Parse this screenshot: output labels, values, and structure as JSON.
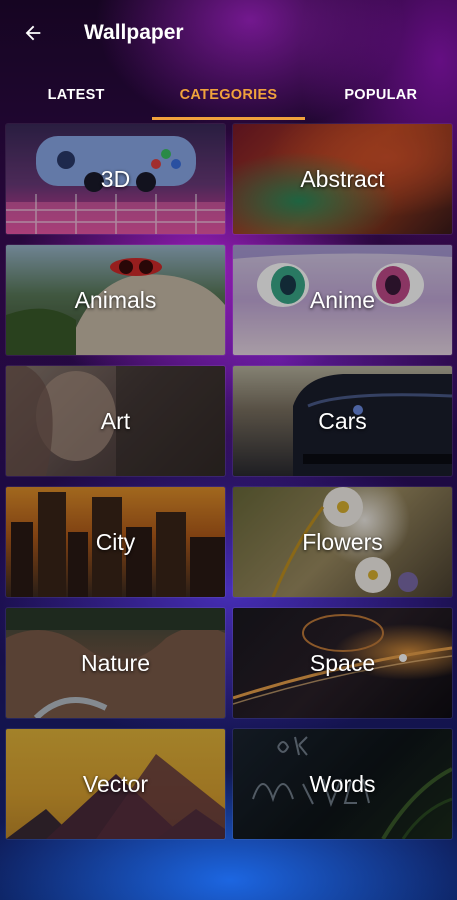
{
  "appbar": {
    "title": "Wallpaper",
    "back_icon": "arrow-left-icon"
  },
  "tabs": [
    {
      "label": "LATEST",
      "active": false
    },
    {
      "label": "CATEGORIES",
      "active": true
    },
    {
      "label": "POPULAR",
      "active": false
    }
  ],
  "colors": {
    "accent": "#f0a23c",
    "text": "#ffffff"
  },
  "categories": [
    {
      "label": "3D"
    },
    {
      "label": "Abstract"
    },
    {
      "label": "Animals"
    },
    {
      "label": "Anime"
    },
    {
      "label": "Art"
    },
    {
      "label": "Cars"
    },
    {
      "label": "City"
    },
    {
      "label": "Flowers"
    },
    {
      "label": "Nature"
    },
    {
      "label": "Space"
    },
    {
      "label": "Vector"
    },
    {
      "label": "Words"
    }
  ]
}
